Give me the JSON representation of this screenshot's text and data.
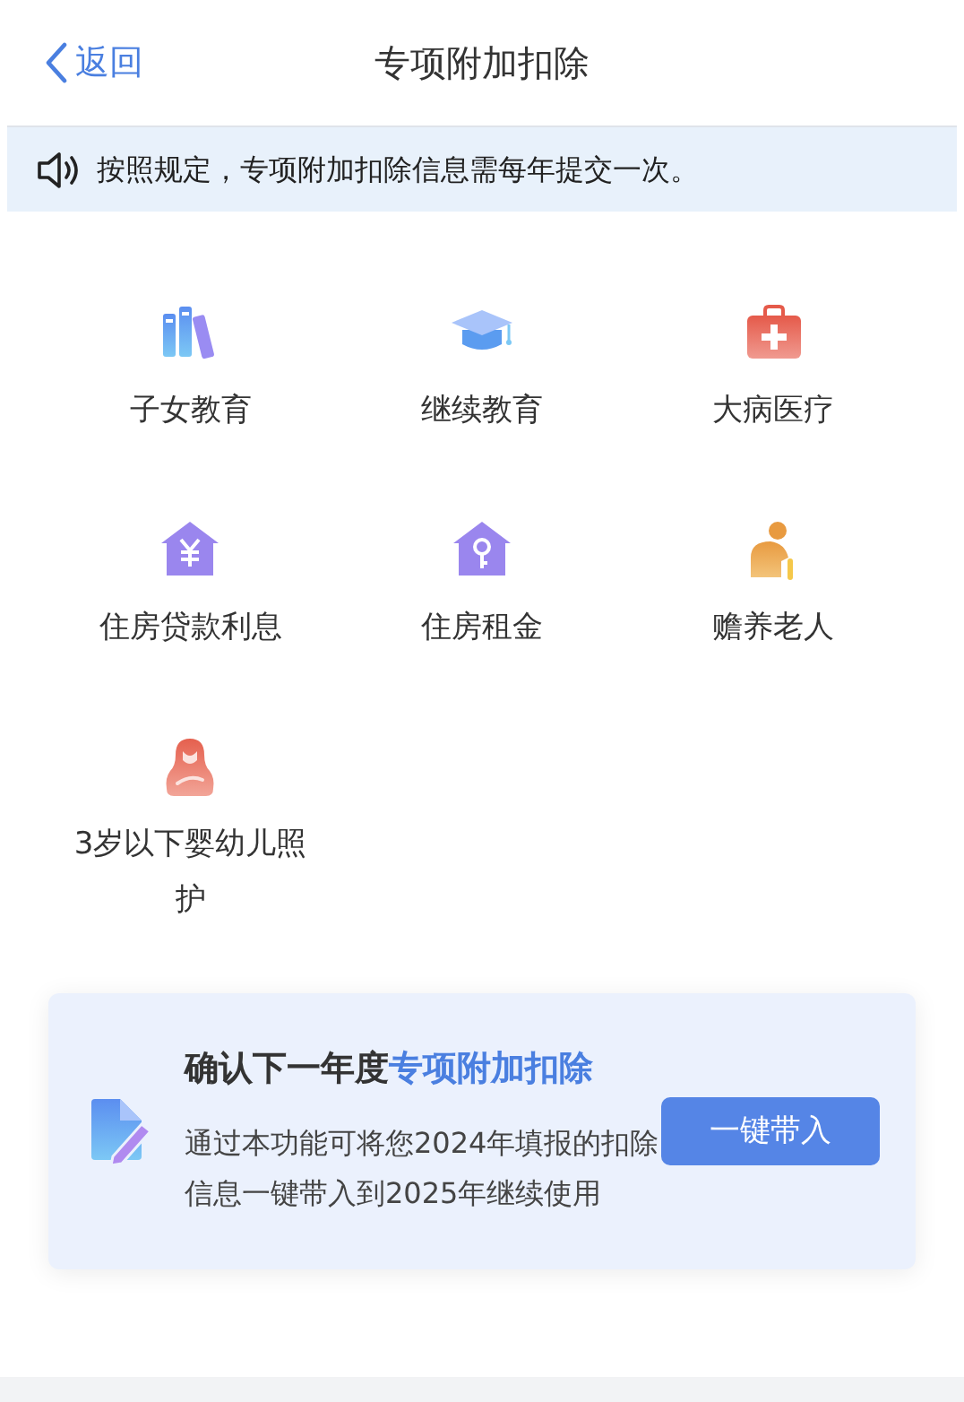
{
  "nav": {
    "back": "返回",
    "title": "专项附加扣除"
  },
  "notice": "按照规定，专项附加扣除信息需每年提交一次。",
  "items": [
    {
      "kind": "books",
      "label": "子女教育"
    },
    {
      "kind": "cap",
      "label": "继续教育"
    },
    {
      "kind": "medkit",
      "label": "大病医疗"
    },
    {
      "kind": "house-yen",
      "label": "住房贷款利息"
    },
    {
      "kind": "house-key",
      "label": "住房租金"
    },
    {
      "kind": "elder",
      "label": "赡养老人"
    },
    {
      "kind": "mother",
      "label": "3岁以下婴幼儿照护"
    }
  ],
  "card": {
    "title": "确认下一年度",
    "title_highlight": "专项附加扣除",
    "text": "通过本功能可将您2024年填报的扣除信息一键带入到2025年继续使用",
    "button": "一键带入"
  }
}
